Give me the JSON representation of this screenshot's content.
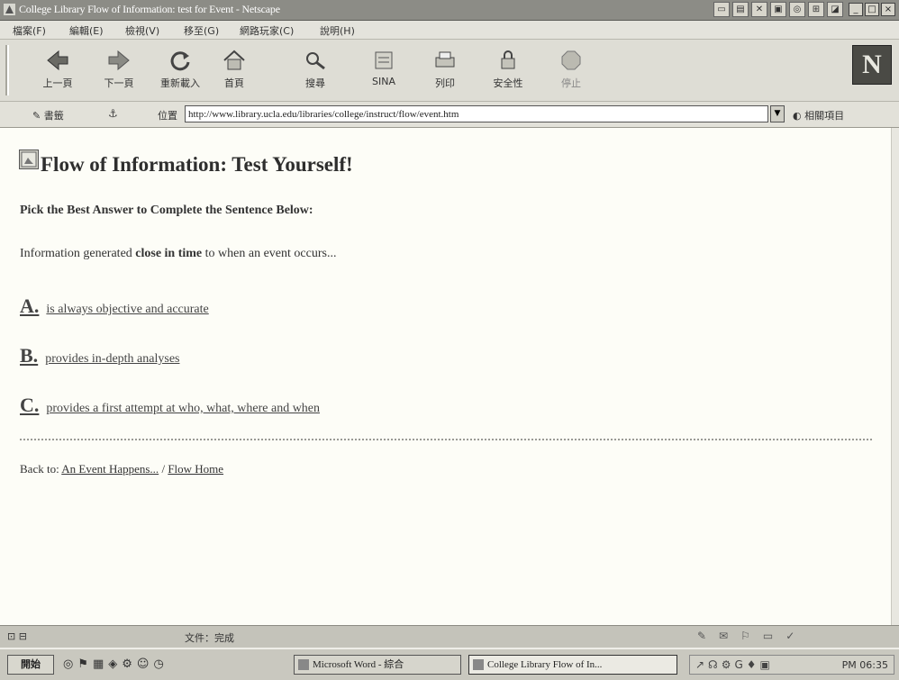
{
  "window": {
    "title": "College Library Flow of Information: test for Event - Netscape"
  },
  "menu": {
    "items": [
      "檔案(F)",
      "編輯(E)",
      "檢視(V)",
      "移至(G)",
      "網路玩家(C)",
      "說明(H)"
    ]
  },
  "toolbar": {
    "buttons": [
      {
        "label": "上一頁",
        "icon": "back-arrow-icon"
      },
      {
        "label": "下一頁",
        "icon": "forward-arrow-icon"
      },
      {
        "label": "重新載入",
        "icon": "reload-icon"
      },
      {
        "label": "首頁",
        "icon": "home-icon"
      },
      {
        "label": "搜尋",
        "icon": "search-icon"
      },
      {
        "label": "SINA",
        "icon": "sina-icon"
      },
      {
        "label": "列印",
        "icon": "print-icon"
      },
      {
        "label": "安全性",
        "icon": "security-icon"
      },
      {
        "label": "停止",
        "icon": "stop-icon"
      }
    ],
    "logo": "N"
  },
  "location": {
    "bookmarks_label": "書籤",
    "label": "位置",
    "url": "http://www.library.ucla.edu/libraries/college/instruct/flow/event.htm",
    "related_label": "相關項目"
  },
  "page": {
    "heading": "Flow of Information: Test Yourself!",
    "instruction": "Pick the Best Answer to Complete the Sentence Below:",
    "question_pre": "Information generated ",
    "question_bold": "close in time",
    "question_post": " to when an event occurs...",
    "options": [
      {
        "letter": "A.",
        "text": "is always objective and accurate"
      },
      {
        "letter": "B.",
        "text": "provides in-depth analyses"
      },
      {
        "letter": "C.",
        "text": "provides a first attempt at who, what, where and when"
      }
    ],
    "back_label": "Back to:",
    "back_link_1": "An Event Happens...",
    "back_separator": "/",
    "back_link_2": "Flow Home"
  },
  "status": {
    "text": "文件：完成"
  },
  "taskbar": {
    "start_label": "開始",
    "tasks": [
      {
        "label": "Microsoft Word - 綜合"
      },
      {
        "label": "College Library Flow of In..."
      }
    ],
    "clock": "PM 06:35"
  },
  "colors": {
    "title_bar": "#8c8c86",
    "page_bg": "#fdfdf7",
    "text": "#333333"
  }
}
